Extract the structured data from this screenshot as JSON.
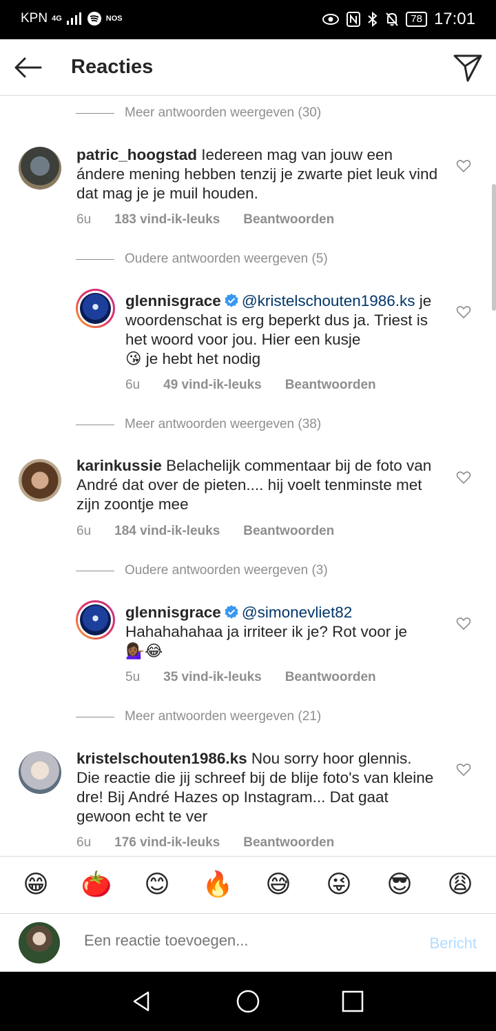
{
  "status_bar": {
    "carrier": "KPN",
    "network": "4G",
    "app_badge": "NOS",
    "battery": "78",
    "time": "17:01"
  },
  "header": {
    "title": "Reacties"
  },
  "threads": [
    {
      "more_label": "Meer antwoorden weergeven (30)"
    },
    {
      "comment": {
        "username": "patric_hoogstad",
        "text": "Iedereen mag van jouw een ándere mening hebben tenzij je zwarte piet leuk vind dat mag je je muil houden.",
        "time": "6u",
        "likes": "183 vind-ik-leuks",
        "reply": "Beantwoorden"
      },
      "older_label": "Oudere antwoorden weergeven (5)",
      "reply": {
        "username": "glennisgrace",
        "mention": "@kristelschouten1986.ks",
        "text": "je woordenschat is erg beperkt dus ja. Triest is het woord voor jou. Hier een kusje",
        "text2": "je hebt het nodig",
        "emoji1": "😘",
        "time": "6u",
        "likes": "49 vind-ik-leuks",
        "reply": "Beantwoorden"
      },
      "more_label": "Meer antwoorden weergeven (38)"
    },
    {
      "comment": {
        "username": "karinkussie",
        "text": "Belachelijk commentaar bij de foto van André dat over de pieten.... hij voelt tenminste met zijn zoontje mee",
        "time": "6u",
        "likes": "184 vind-ik-leuks",
        "reply": "Beantwoorden"
      },
      "older_label": "Oudere antwoorden weergeven (3)",
      "reply": {
        "username": "glennisgrace",
        "mention": "@simonevliet82",
        "text": "Hahahahahaa ja irriteer ik je? Rot voor je",
        "emoji1": "💁🏾‍♀️",
        "emoji2": "😂",
        "time": "5u",
        "likes": "35 vind-ik-leuks",
        "reply": "Beantwoorden"
      },
      "more_label": "Meer antwoorden weergeven (21)"
    },
    {
      "comment": {
        "username": "kristelschouten1986.ks",
        "text": "Nou sorry hoor glennis. Die reactie die jij schreef bij de blije foto's van kleine dre! Bij André Hazes op Instagram... Dat gaat gewoon echt te ver",
        "time": "6u",
        "likes": "176 vind-ik-leuks",
        "reply": "Beantwoorden"
      }
    }
  ],
  "emoji_bar": [
    "😁",
    "🍅",
    "😊",
    "🔥",
    "😅",
    "😜",
    "😎",
    "😩"
  ],
  "composer": {
    "placeholder": "Een reactie toevoegen...",
    "post_label": "Bericht"
  },
  "colors": {
    "accent": "#3897f0",
    "secondary_text": "#8e8e8e",
    "mention": "#003569",
    "post_disabled": "#b3dbff"
  }
}
